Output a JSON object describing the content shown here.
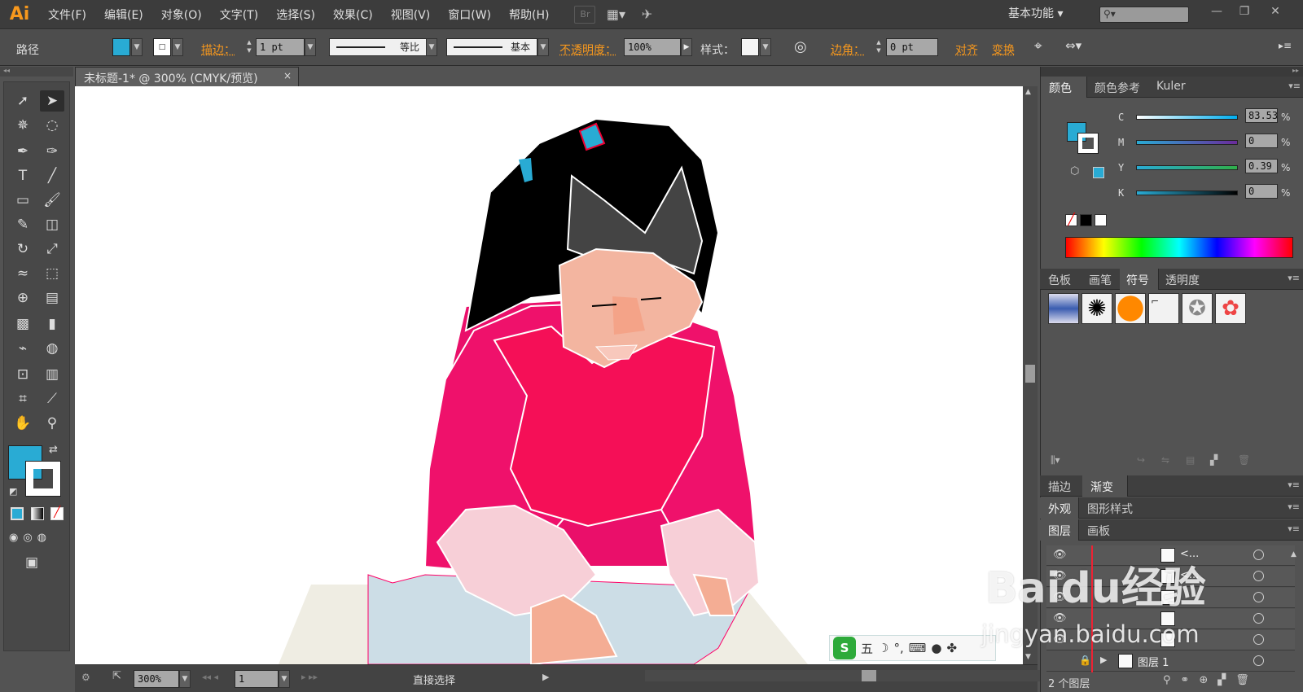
{
  "app": {
    "logo": "Ai"
  },
  "menu": [
    "文件(F)",
    "编辑(E)",
    "对象(O)",
    "文字(T)",
    "选择(S)",
    "效果(C)",
    "视图(V)",
    "窗口(W)",
    "帮助(H)"
  ],
  "menu_icons": {
    "bridge": "Br"
  },
  "workspace": "基本功能",
  "control": {
    "path_label": "路径",
    "fill_color": "#29abd4",
    "stroke_label": "描边：",
    "stroke_weight": "1 pt",
    "stroke_profile": "等比",
    "brush": "基本",
    "opacity_label": "不透明度：",
    "opacity": "100%",
    "style_label": "样式：",
    "corner_label": "边角：",
    "corner_value": "0 pt",
    "align_label": "对齐",
    "transform_label": "变换"
  },
  "document": {
    "tab_title": "未标题-1* @ 300% (CMYK/预览)",
    "close": "×"
  },
  "status": {
    "zoom": "300%",
    "page": "1",
    "tool": "直接选择"
  },
  "colors": {
    "fill": "#29abd4",
    "stroke": "#ffffff",
    "accent": "#f7981d"
  },
  "color_panel": {
    "tabs": [
      "颜色",
      "颜色参考",
      "Kuler"
    ],
    "channels": [
      {
        "name": "C",
        "value": "83.53"
      },
      {
        "name": "M",
        "value": "0"
      },
      {
        "name": "Y",
        "value": "0.39"
      },
      {
        "name": "K",
        "value": "0"
      }
    ],
    "percent": "%"
  },
  "symbols_panel": {
    "tabs": [
      "色板",
      "画笔",
      "符号",
      "透明度"
    ]
  },
  "stroke_panel": {
    "tabs": [
      "描边",
      "渐变"
    ]
  },
  "appearance_panel": {
    "tabs": [
      "外观",
      "图形样式"
    ]
  },
  "layers_panel": {
    "tabs": [
      "图层",
      "画板"
    ],
    "rows": [
      "<...",
      "<...",
      "",
      "",
      ""
    ],
    "layer_name": "图层 1",
    "footer": "2 个图层"
  },
  "ime": {
    "mode": "五"
  },
  "watermark": {
    "brand": "Baidu经验",
    "url": "jingyan.baidu.com"
  }
}
